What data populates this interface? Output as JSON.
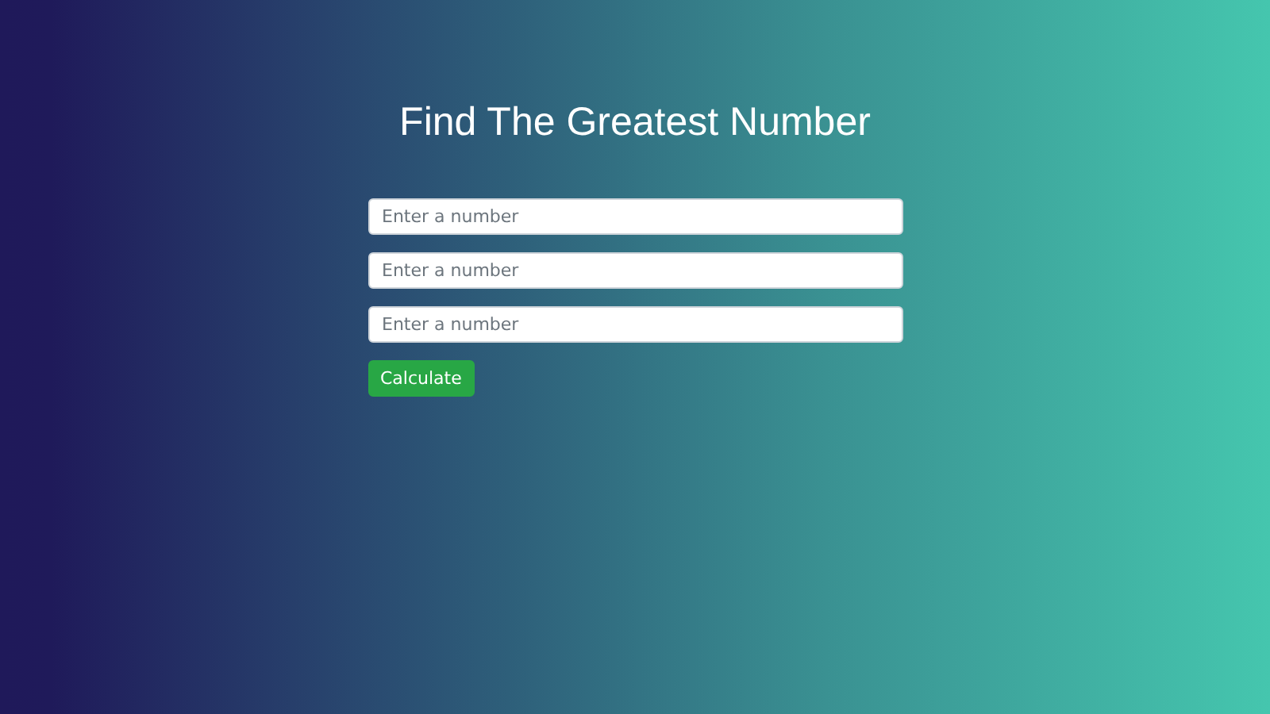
{
  "title": "Find The Greatest Number",
  "fields": [
    {
      "placeholder": "Enter a number"
    },
    {
      "placeholder": "Enter a number"
    },
    {
      "placeholder": "Enter a number"
    }
  ],
  "button": "Calculate"
}
